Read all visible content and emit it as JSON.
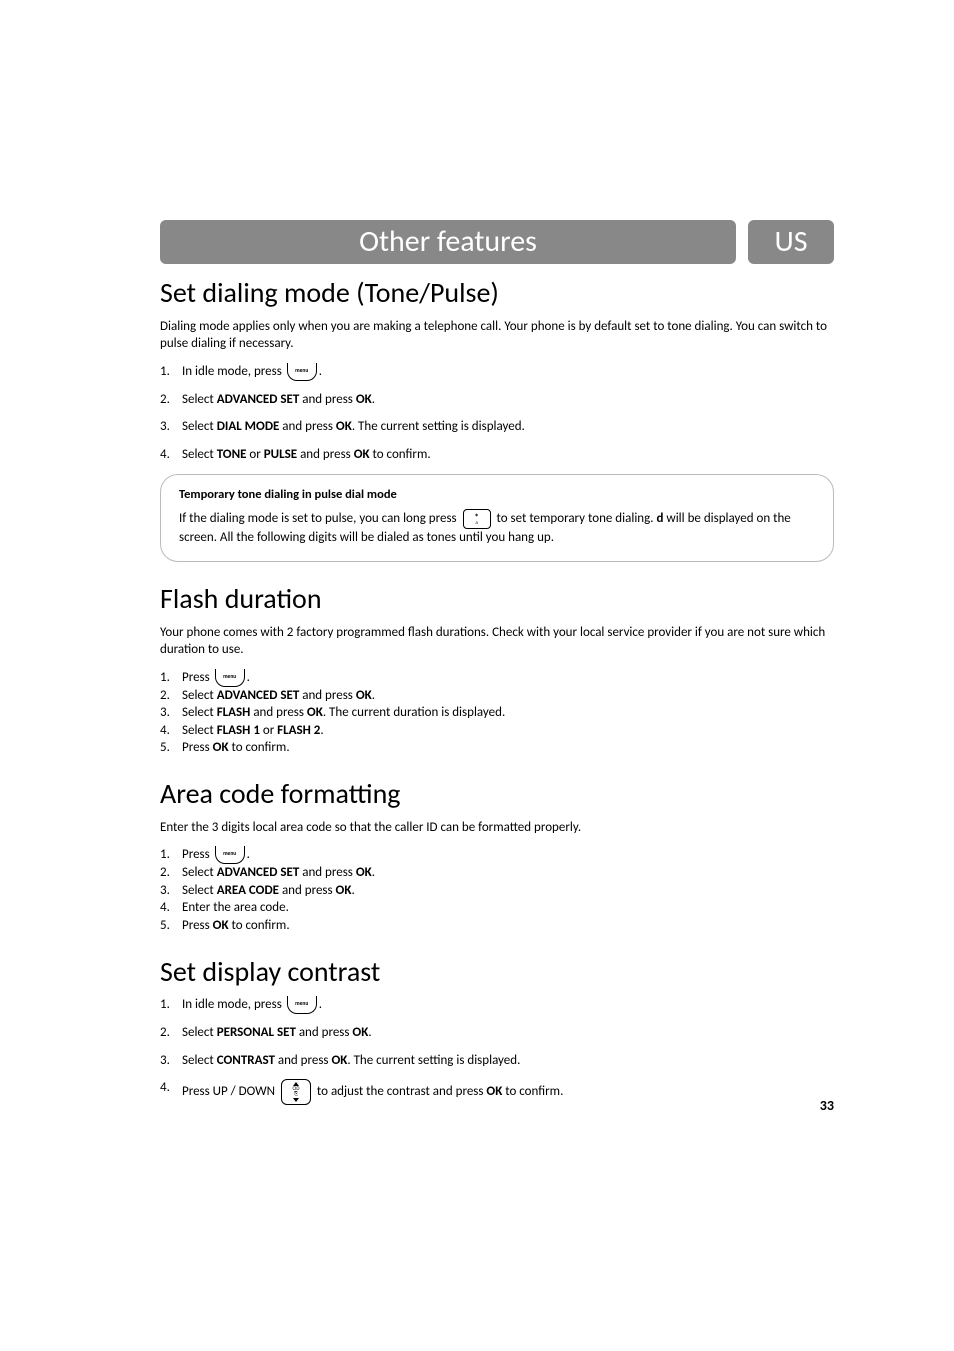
{
  "header": {
    "title": "Other features",
    "locale": "US"
  },
  "keys": {
    "menu": "menu",
    "star_main": "*",
    "star_sub": "a",
    "nav_top": "CID"
  },
  "sections": {
    "dialing": {
      "heading": "Set dialing mode (Tone/Pulse)",
      "intro": "Dialing mode applies only when you are making a telephone call. Your phone is by default set to tone dialing. You can switch to pulse dialing if necessary.",
      "steps": [
        {
          "pre": "In idle mode, press ",
          "post": "."
        },
        {
          "pre": "Select ",
          "b1": "ADVANCED SET",
          "mid": " and press ",
          "b2": "OK",
          "post": "."
        },
        {
          "pre": "Select ",
          "b1": "DIAL MODE",
          "mid": " and press ",
          "b2": "OK",
          "post": ". The current setting is displayed."
        },
        {
          "pre": "Select ",
          "b1": "TONE",
          "mid": " or ",
          "b2": "PULSE",
          "mid2": " and press ",
          "b3": "OK",
          "post": " to confirm."
        }
      ],
      "callout": {
        "title": "Temporary tone dialing in pulse dial mode",
        "pre": "If the dialing mode is set to pulse, you can long press ",
        "mid": " to set temporary tone dialing. ",
        "bold_d": "d",
        "post": " will be displayed on the screen. All the following digits will be dialed as tones until you hang up."
      }
    },
    "flash": {
      "heading": "Flash duration",
      "intro": "Your phone comes with 2 factory programmed flash durations.  Check with your local service provider if you are not sure which duration to use.",
      "steps": [
        {
          "pre": "Press ",
          "post": "."
        },
        {
          "pre": "Select ",
          "b1": "ADVANCED SET",
          "mid": " and press ",
          "b2": "OK",
          "post": "."
        },
        {
          "pre": "Select ",
          "b1": "FLASH",
          "mid": " and press ",
          "b2": "OK",
          "post": ".   The current duration is displayed."
        },
        {
          "pre": "Select ",
          "b1": "FLASH 1",
          "mid": " or ",
          "b2": "FLASH 2",
          "post": "."
        },
        {
          "pre": "Press ",
          "b1": "OK",
          "post": " to confirm."
        }
      ]
    },
    "area": {
      "heading": "Area code formatting",
      "intro": "Enter the 3 digits local area code so that the caller ID can be formatted properly.",
      "steps": [
        {
          "pre": "Press ",
          "post": "."
        },
        {
          "pre": "Select ",
          "b1": "ADVANCED SET",
          "mid": " and press ",
          "b2": "OK",
          "post": "."
        },
        {
          "pre": "Select ",
          "b1": "AREA CODE",
          "mid": " and press ",
          "b2": "OK",
          "post": "."
        },
        {
          "pre": "Enter the area code."
        },
        {
          "pre": "Press ",
          "b1": "OK",
          "post": " to confirm."
        }
      ]
    },
    "contrast": {
      "heading": "Set display contrast",
      "steps": [
        {
          "pre": "In idle mode, press ",
          "post": "."
        },
        {
          "pre": "Select ",
          "b1": "PERSONAL SET",
          "mid": " and press ",
          "b2": "OK",
          "post": "."
        },
        {
          "pre": "Select ",
          "b1": "CONTRAST",
          "mid": " and press ",
          "b2": "OK",
          "post": ". The current setting is displayed."
        },
        {
          "pre": "Press  UP / DOWN ",
          "mid": " to adjust the contrast and press ",
          "b1": "OK",
          "post": " to confirm."
        }
      ]
    }
  },
  "page_number": "33"
}
